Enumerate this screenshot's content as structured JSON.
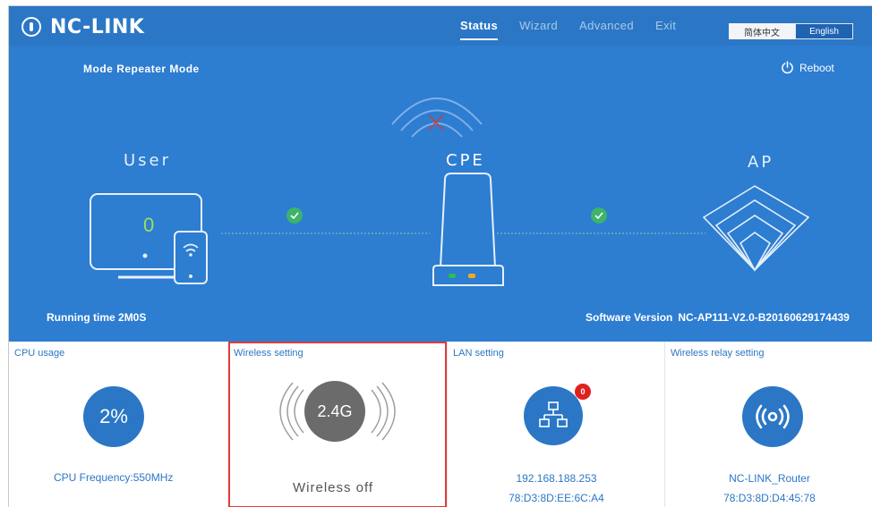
{
  "brand": {
    "name": "NC-LINK"
  },
  "nav": {
    "items": [
      {
        "label": "Status",
        "active": true
      },
      {
        "label": "Wizard",
        "active": false
      },
      {
        "label": "Advanced",
        "active": false
      },
      {
        "label": "Exit",
        "active": false
      }
    ]
  },
  "language": {
    "zh_label": "简体中文",
    "en_label": "English",
    "selected": "English"
  },
  "status": {
    "mode_label": "Mode",
    "mode_value": "Repeater Mode",
    "reboot_label": "Reboot",
    "user_label": "User",
    "cpe_label": "CPE",
    "ap_label": "AP",
    "user_count": "0",
    "running_label": "Running time",
    "running_value": "2M0S",
    "software_label": "Software Version",
    "software_value": "NC-AP111-V2.0-B20160629174439"
  },
  "cards": {
    "cpu": {
      "title": "CPU usage",
      "usage": "2%",
      "frequency": "CPU Frequency:550MHz"
    },
    "wireless": {
      "title": "Wireless setting",
      "band": "2.4G",
      "state": "Wireless off"
    },
    "lan": {
      "title": "LAN setting",
      "badge": "0",
      "ip": "192.168.188.253",
      "mac": "78:D3:8D:EE:6C:A4"
    },
    "relay": {
      "title": "Wireless relay setting",
      "ssid": "NC-LINK_Router",
      "mac": "78:D3:8D:D4:45:78"
    }
  },
  "colors": {
    "primary": "#2d7dd1",
    "nav_bar": "#2b77c5",
    "check_green": "#3db36b",
    "highlight_red": "#e03a3a",
    "led_green": "#26c24a",
    "led_orange": "#f5a623"
  }
}
